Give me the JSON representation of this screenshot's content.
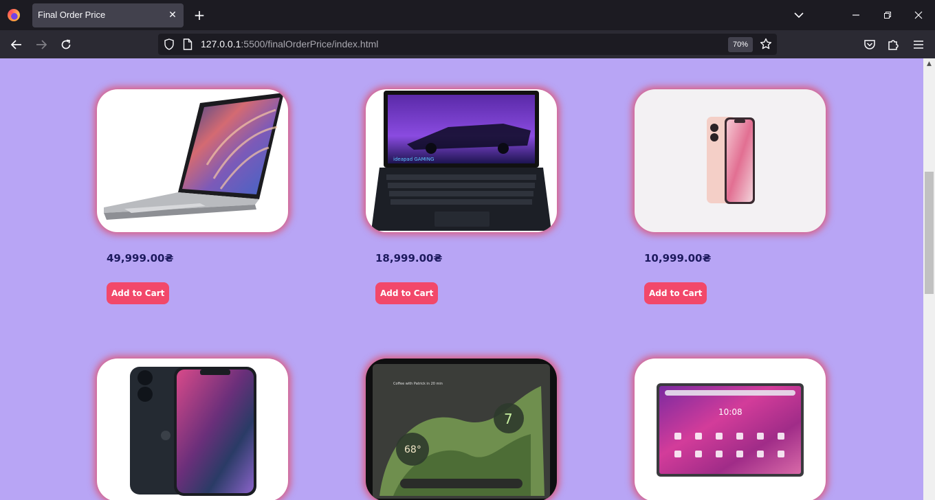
{
  "browser": {
    "tab_title": "Final Order Price",
    "url_host": "127.0.0.1",
    "url_path": ":5500/finalOrderPrice/index.html",
    "zoom": "70%"
  },
  "page": {
    "background": "#b8a5f5",
    "button_color": "#f2486a",
    "products": [
      {
        "image": "silver-laptop",
        "price": "49,999.00₴",
        "button": "Add to Cart"
      },
      {
        "image": "gaming-laptop",
        "price": "18,999.00₴",
        "button": "Add to Cart"
      },
      {
        "image": "pink-phone",
        "price": "10,999.00₴",
        "button": "Add to Cart"
      },
      {
        "image": "midnight-phone"
      },
      {
        "image": "android-tablet"
      },
      {
        "image": "pink-tablet"
      }
    ]
  }
}
